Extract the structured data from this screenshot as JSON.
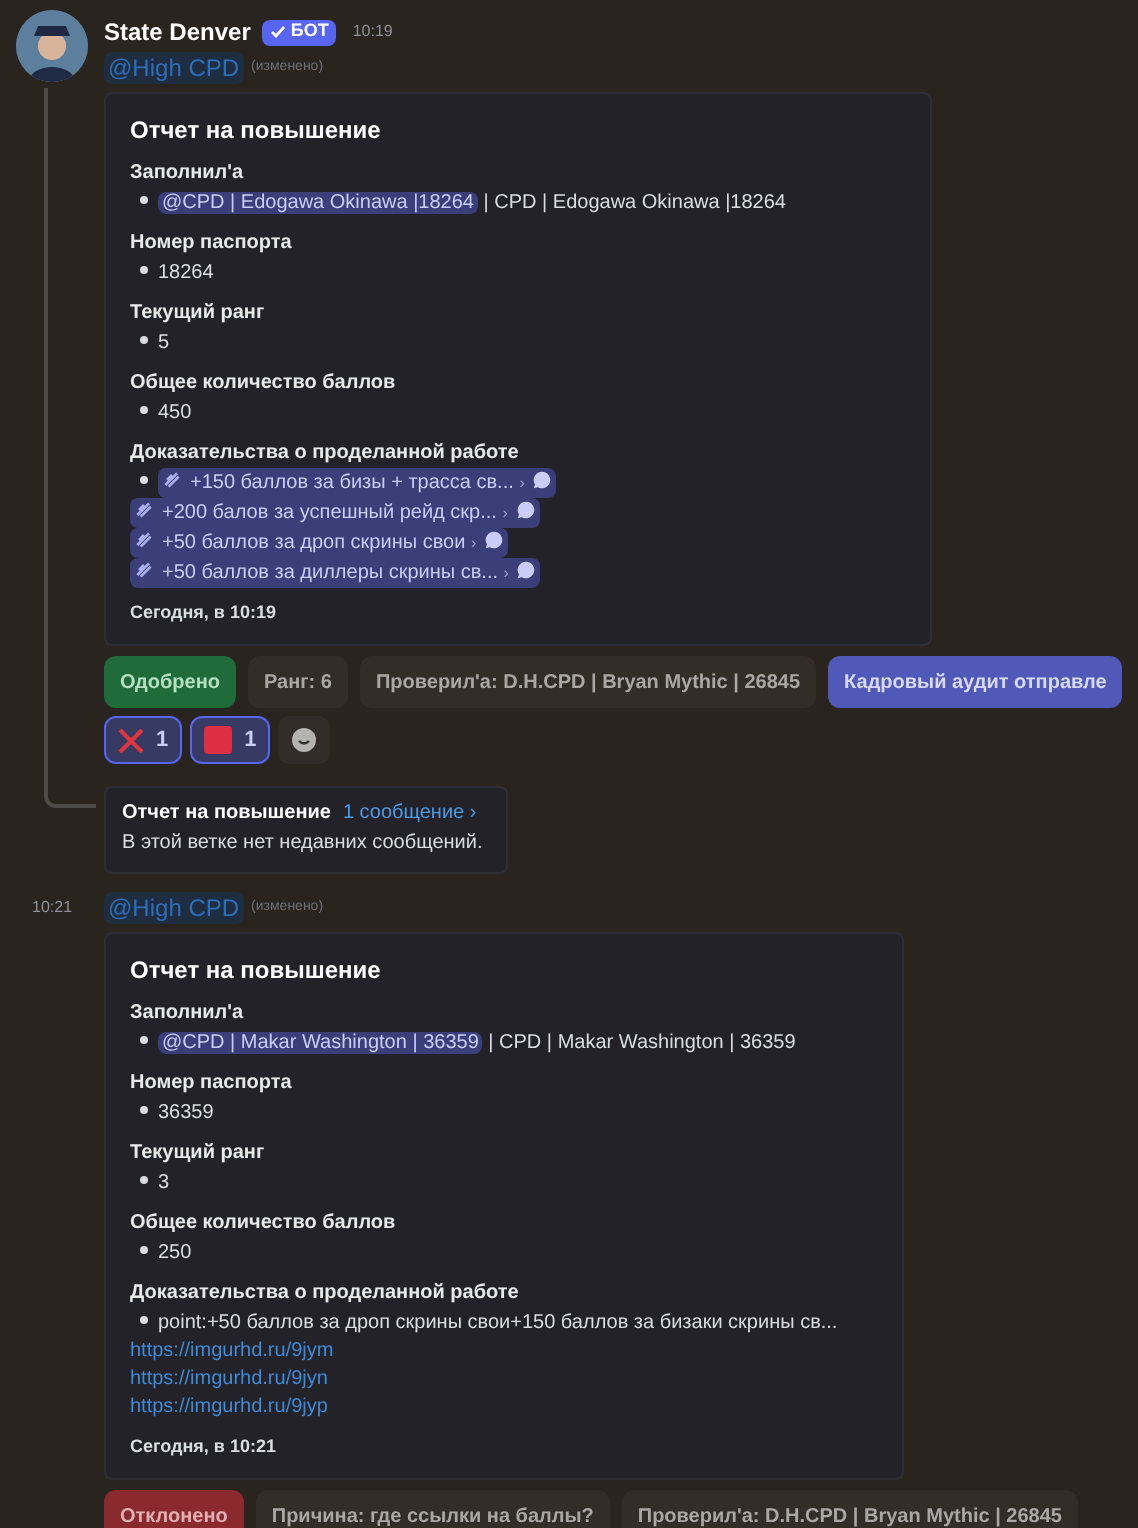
{
  "messages": [
    {
      "author": "State Denver",
      "badge": "БОТ",
      "time": "10:19",
      "mention": "@High CPD",
      "edited": "(изменено)",
      "embed": {
        "title": "Отчет на повышение",
        "fields": [
          {
            "name": "Заполнил'а",
            "bullet": [
              {
                "kind": "mention",
                "text": "@CPD | Edogawa Okinawa |18264"
              },
              {
                "kind": "text",
                "text": " | CPD | Edogawa Okinawa |18264"
              }
            ]
          },
          {
            "name": "Номер паспорта",
            "bullet": [
              {
                "kind": "text",
                "text": "18264"
              }
            ]
          },
          {
            "name": "Текущий ранг",
            "bullet": [
              {
                "kind": "text",
                "text": "5"
              }
            ]
          },
          {
            "name": "Общее количество баллов",
            "bullet": [
              {
                "kind": "text",
                "text": "450"
              }
            ]
          },
          {
            "name": "Доказательства о проделанной работе",
            "bullet": [
              {
                "kind": "chip",
                "text": "+150 баллов за бизы + трасса св...",
                "arrow": "›"
              },
              {
                "kind": "chip",
                "text": "+200 балов за успешный рейд скр...",
                "arrow": "›"
              },
              {
                "kind": "chip",
                "text": "+50 баллов за дроп скрины свои",
                "arrow": "›"
              },
              {
                "kind": "chip",
                "text": "+50 баллов за диллеры скрины св...",
                "arrow": "›"
              }
            ]
          }
        ],
        "footer": "Сегодня, в 10:19"
      },
      "buttons": [
        {
          "label": "Одобрено",
          "kind": "success"
        },
        {
          "label": "Ранг: 6",
          "kind": "secondary"
        },
        {
          "label": "Проверил'а: D.H.CPD | Bryan Mythic | 26845",
          "kind": "secondary"
        },
        {
          "label": "Кадровый аудит отправле",
          "kind": "primary"
        }
      ],
      "reactions": [
        {
          "kind": "cross",
          "count": "1",
          "selected": true
        },
        {
          "kind": "square",
          "count": "1",
          "selected": true
        },
        {
          "kind": "add"
        }
      ],
      "thread": {
        "title": "Отчет на повышение",
        "link": "1 сообщение ›",
        "note": "В этой ветке нет недавних сообщений."
      }
    },
    {
      "time": "10:21",
      "mention": "@High CPD",
      "edited": "(изменено)",
      "embed": {
        "title": "Отчет на повышение",
        "fields": [
          {
            "name": "Заполнил'а",
            "bullet": [
              {
                "kind": "mention",
                "text": "@CPD | Makar Washington | 36359"
              },
              {
                "kind": "text",
                "text": " | CPD | Makar Washington | 36359"
              }
            ]
          },
          {
            "name": "Номер паспорта",
            "bullet": [
              {
                "kind": "text",
                "text": "36359"
              }
            ]
          },
          {
            "name": "Текущий ранг",
            "bullet": [
              {
                "kind": "text",
                "text": "3"
              }
            ]
          },
          {
            "name": "Общее количество баллов",
            "bullet": [
              {
                "kind": "text",
                "text": "250"
              }
            ]
          },
          {
            "name": "Доказательства о проделанной работе",
            "bullet": [
              {
                "kind": "text",
                "text": "point:+50 баллов за дроп скрины свои+150 баллов за бизаки скрины св..."
              }
            ],
            "links": [
              "https://imgurhd.ru/9jym",
              "https://imgurhd.ru/9jyn",
              "https://imgurhd.ru/9jyp"
            ]
          }
        ],
        "footer": "Сегодня, в 10:21"
      },
      "buttons": [
        {
          "label": "Отклонено",
          "kind": "danger"
        },
        {
          "label": "Причина: где ссылки на баллы?",
          "kind": "secondary"
        },
        {
          "label": "Проверил'а: D.H.CPD | Bryan Mythic | 26845",
          "kind": "secondary"
        }
      ]
    }
  ]
}
